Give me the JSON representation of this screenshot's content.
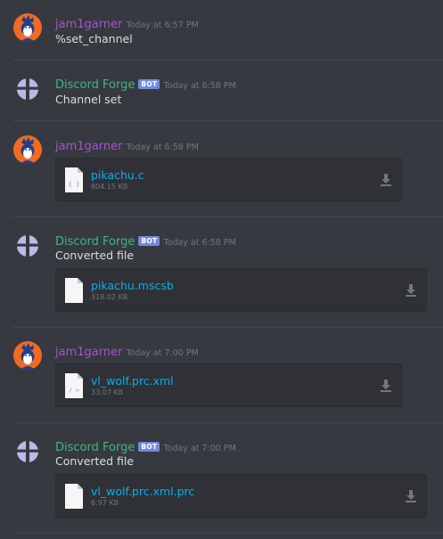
{
  "messages": [
    {
      "author": "jam1garner",
      "badge": "",
      "timestamp": "Today at 6:57 PM",
      "text": "%set_channel"
    },
    {
      "author": "Discord Forge",
      "badge": "BOT",
      "timestamp": "Today at 6:58 PM",
      "text": "Channel set"
    },
    {
      "author": "jam1garner",
      "badge": "",
      "timestamp": "Today at 6:58 PM",
      "attachment": {
        "name": "pikachu.c",
        "size": "804.15 KB",
        "icon": "code-braces-file-icon",
        "glyph": "{ }"
      }
    },
    {
      "author": "Discord Forge",
      "badge": "BOT",
      "timestamp": "Today at 6:58 PM",
      "text": "Converted file",
      "attachment": {
        "name": "pikachu.mscsb",
        "size": "318.02 KB",
        "icon": "blank-file-icon",
        "glyph": ""
      }
    },
    {
      "author": "jam1garner",
      "badge": "",
      "timestamp": "Today at 7:00 PM",
      "attachment": {
        "name": "vl_wolf.prc.xml",
        "size": "33.07 KB",
        "icon": "markup-file-icon",
        "glyph": "/ >"
      }
    },
    {
      "author": "Discord Forge",
      "badge": "BOT",
      "timestamp": "Today at 7:00 PM",
      "text": "Converted file",
      "attachment": {
        "name": "vl_wolf.prc.xml.prc",
        "size": "6.97 KB",
        "icon": "blank-file-icon",
        "glyph": ""
      }
    }
  ],
  "colors": {
    "background": "#36393f",
    "user_name": "#a652d2",
    "bot_name": "#43b581",
    "link": "#00b0f4",
    "badge": "#7289da"
  }
}
